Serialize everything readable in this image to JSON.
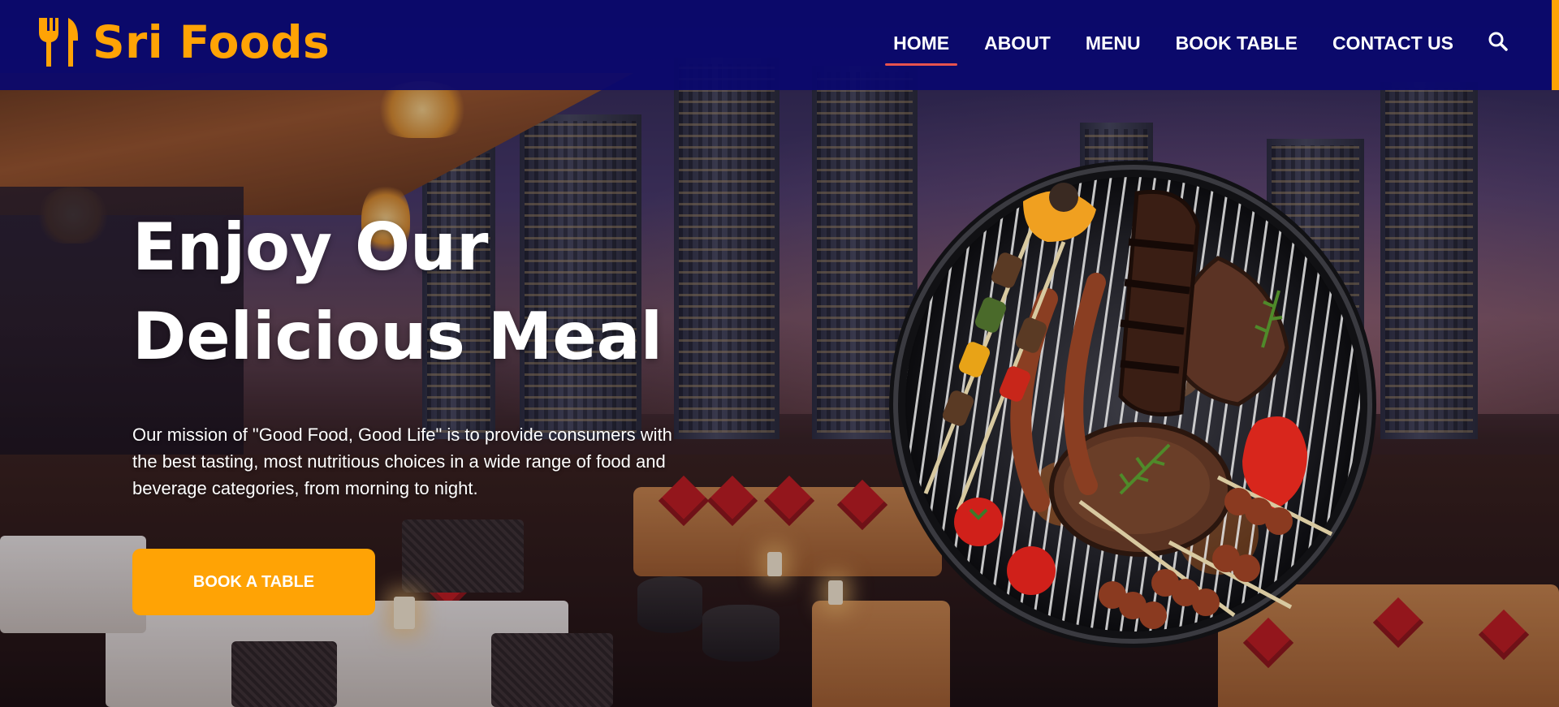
{
  "brand": {
    "name": "Sri Foods",
    "logo_icon": "fork-knife-icon",
    "color": "#ffa305"
  },
  "header": {
    "background": "#0a086e",
    "nav": [
      {
        "label": "HOME",
        "active": true
      },
      {
        "label": "ABOUT",
        "active": false
      },
      {
        "label": "MENU",
        "active": false
      },
      {
        "label": "BOOK TABLE",
        "active": false
      },
      {
        "label": "CONTACT US",
        "active": false
      }
    ],
    "search_icon": "search-icon",
    "active_indicator_color": "#e8534e"
  },
  "hero": {
    "title_line1": "Enjoy Our",
    "title_line2": "Delicious Meal",
    "description": "Our mission of \"Good Food, Good Life\" is to provide consumers with the best tasting, most nutritious choices in a wide range of food and beverage categories, from morning to night.",
    "cta_label": "BOOK A TABLE",
    "cta_color": "#ffa305",
    "image": "barbecue-grill-image",
    "background": "restaurant-terrace-city-night-image"
  }
}
